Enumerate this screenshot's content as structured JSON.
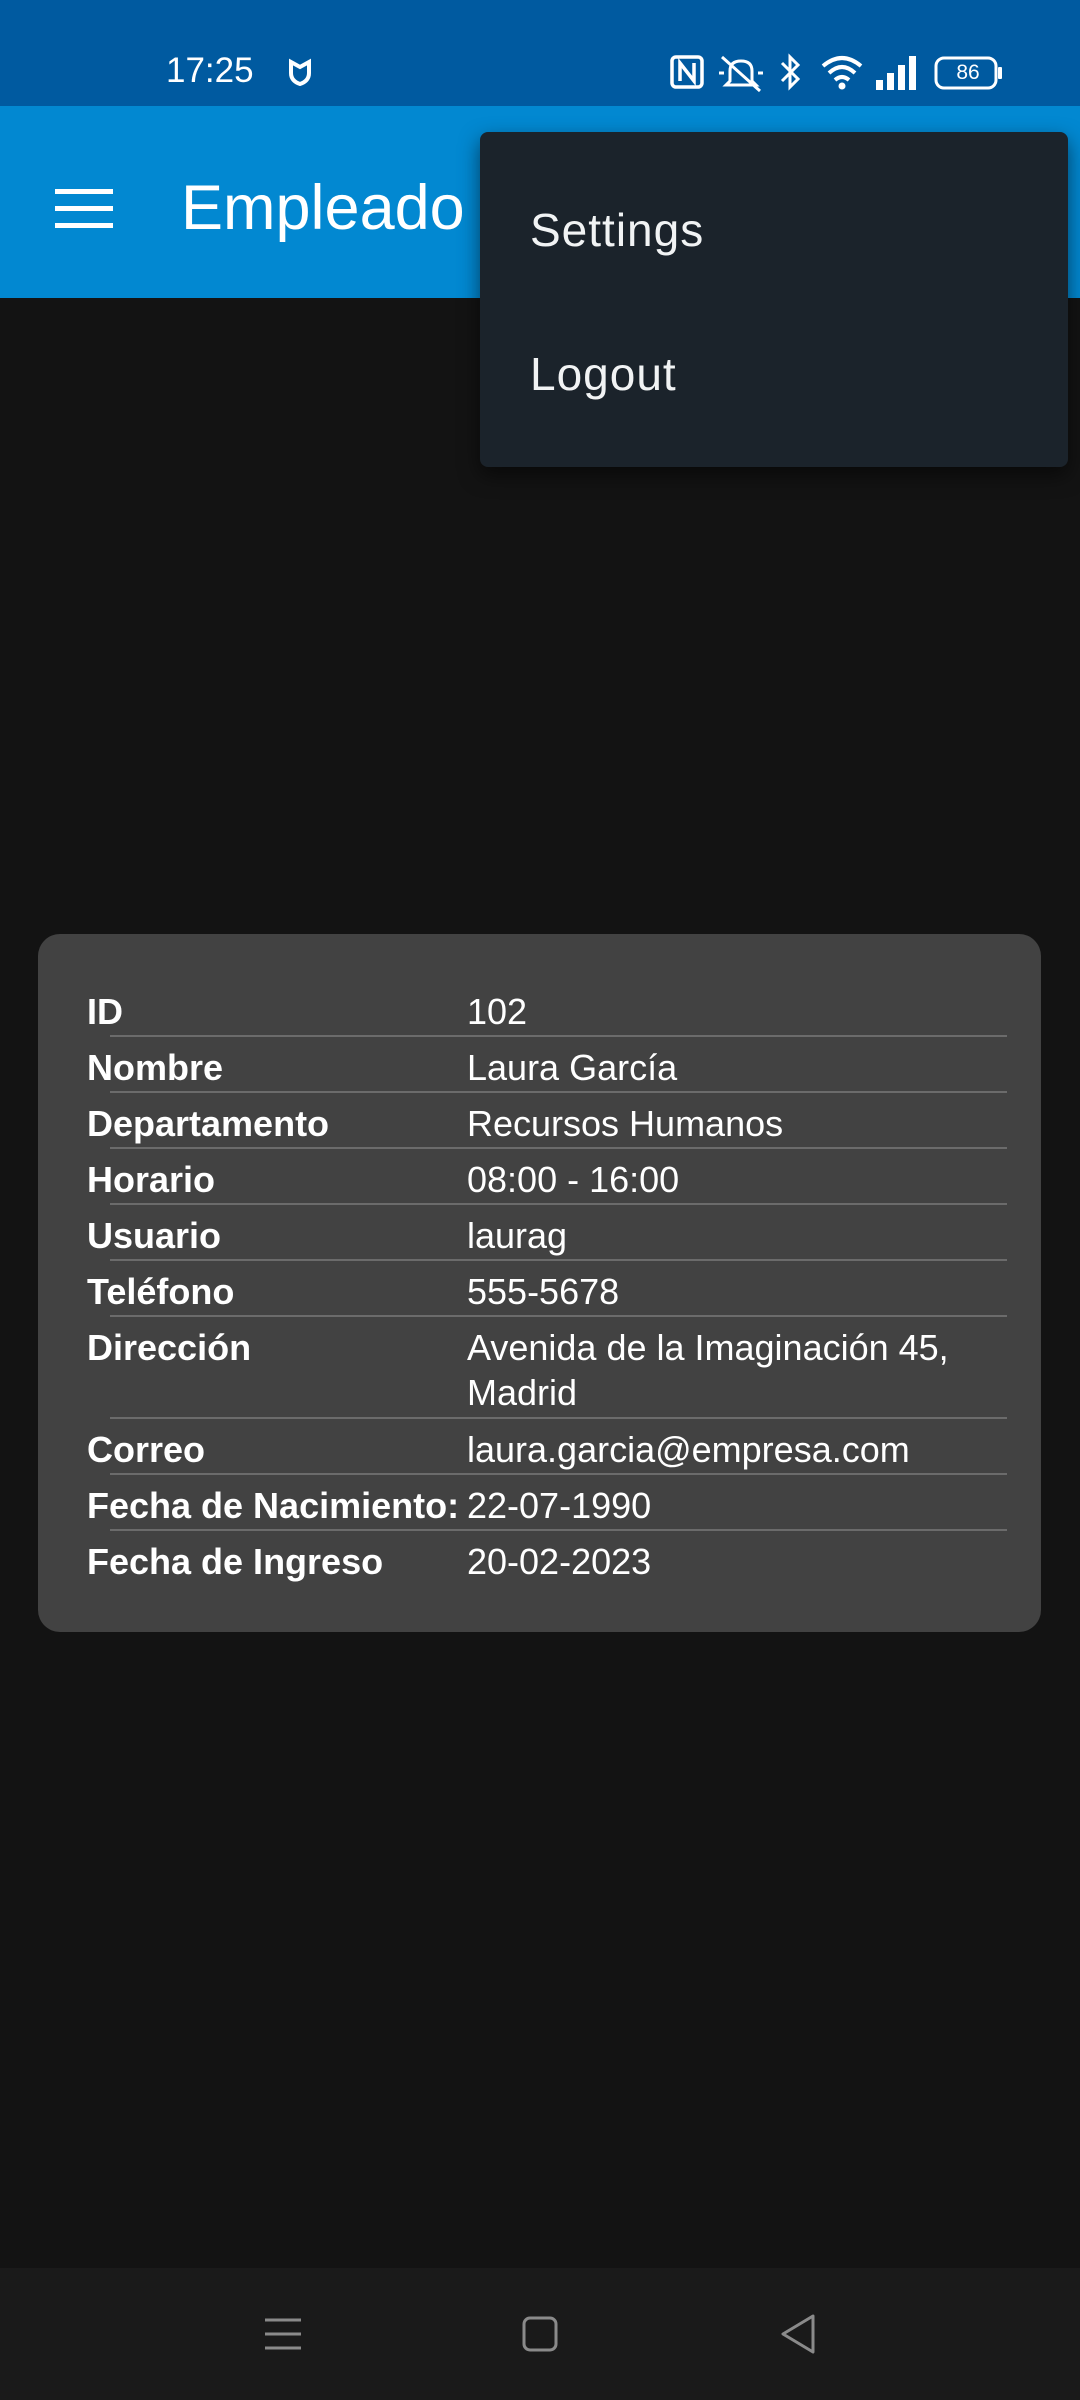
{
  "status_bar": {
    "time": "17:25",
    "battery": "86",
    "icons": [
      "shield-icon",
      "nfc-icon",
      "bell-muted-icon",
      "bluetooth-icon",
      "wifi-icon",
      "signal-icon",
      "battery-icon"
    ]
  },
  "app_bar": {
    "title": "Empleado",
    "menu_icon": "hamburger-menu-icon"
  },
  "overflow_menu": {
    "items": [
      {
        "label": "Settings"
      },
      {
        "label": "Logout"
      }
    ]
  },
  "employee": {
    "rows": [
      {
        "label": "ID",
        "value": "102"
      },
      {
        "label": "Nombre",
        "value": "Laura García"
      },
      {
        "label": "Departamento",
        "value": "Recursos Humanos"
      },
      {
        "label": "Horario",
        "value": "08:00 - 16:00"
      },
      {
        "label": "Usuario",
        "value": "laurag"
      },
      {
        "label": "Teléfono",
        "value": "555-5678"
      },
      {
        "label": "Dirección",
        "value": "Avenida de la Imaginación 45, Madrid"
      },
      {
        "label": "Correo",
        "value": "laura.garcia@empresa.com"
      },
      {
        "label": "Fecha de Nacimiento:",
        "value": "22-07-1990"
      },
      {
        "label": "Fecha de Ingreso",
        "value": "20-02-2023"
      }
    ]
  },
  "nav_bar": {
    "icons": [
      "recents-icon",
      "home-icon",
      "back-icon"
    ]
  },
  "colors": {
    "status_bar": "#005aa0",
    "app_bar": "#0288d1",
    "background": "#131313",
    "card": "#424242",
    "menu": "#1b232b"
  }
}
